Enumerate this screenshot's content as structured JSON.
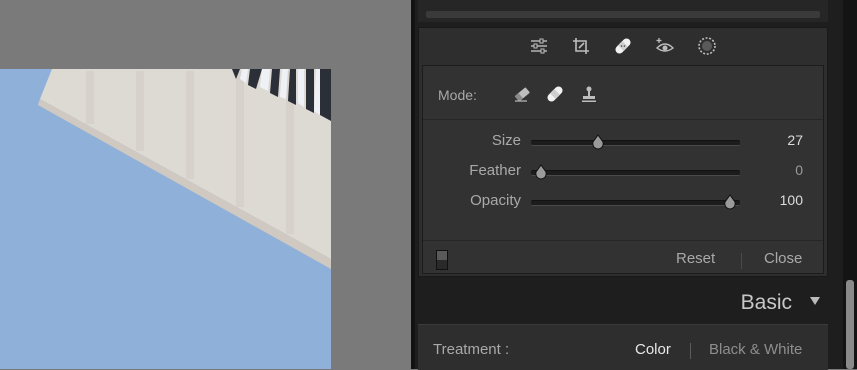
{
  "toolbar": {
    "icons": [
      "adjustments-icon",
      "crop-icon",
      "healing-bandage-icon",
      "red-eye-icon",
      "masking-icon"
    ]
  },
  "spot_removal": {
    "mode_label": "Mode:",
    "modes": [
      "eraser-mode-icon",
      "heal-mode-icon",
      "clone-stamp-mode-icon"
    ],
    "sliders": [
      {
        "label": "Size",
        "value": "27",
        "level": 0.3
      },
      {
        "label": "Feather",
        "value": "0",
        "level": 0.0
      },
      {
        "label": "Opacity",
        "value": "100",
        "level": 1.0
      }
    ],
    "reset_label": "Reset",
    "close_label": "Close"
  },
  "basic": {
    "title": "Basic",
    "treatment_label": "Treatment :",
    "color_option": "Color",
    "bw_option": "Black & White"
  },
  "colors": {
    "sky": "#8fb1d9",
    "panel": "#2e2e2e",
    "accent_text": "#e8e8e8"
  }
}
